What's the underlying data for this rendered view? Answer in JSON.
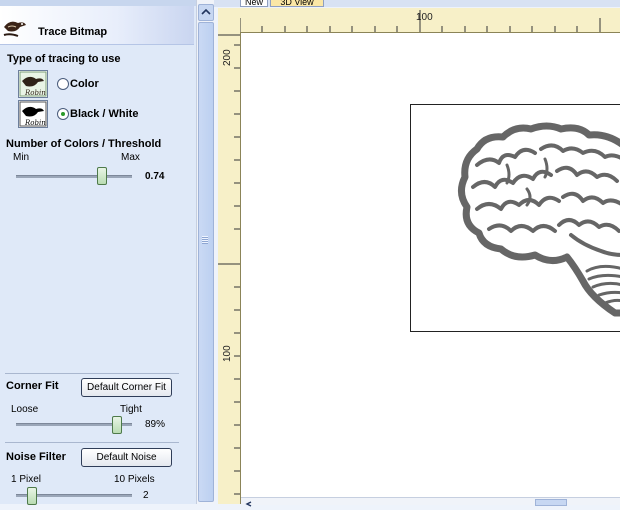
{
  "panel": {
    "title": "Trace Bitmap",
    "tracing_type": {
      "heading": "Type of tracing to use",
      "options": [
        {
          "label": "Color",
          "selected": false
        },
        {
          "label": "Black / White",
          "selected": true
        }
      ]
    },
    "threshold": {
      "heading": "Number of Colors / Threshold",
      "min_label": "Min",
      "max_label": "Max",
      "value_text": "0.74",
      "value": 0.74
    },
    "corner_fit": {
      "heading": "Corner Fit",
      "button_label": "Default Corner Fit",
      "min_label": "Loose",
      "max_label": "Tight",
      "value_text": "89%",
      "value": 0.89
    },
    "noise_filter": {
      "heading": "Noise Filter",
      "button_label": "Default Noise",
      "min_label": "1 Pixel",
      "max_label": "10 Pixels",
      "value_text": "2",
      "value": 2
    }
  },
  "tabs": [
    {
      "label": "New"
    },
    {
      "label": "3D View"
    }
  ],
  "rulers": {
    "top_labels": [
      "100"
    ],
    "left_labels": [
      "200",
      "100"
    ]
  },
  "icons": {
    "panel_icon": "trace-bitmap-icon",
    "thumbnail": "bird-thumbnail-icon"
  },
  "colors": {
    "panel_bg": "#dfe9f8",
    "ruler_bg": "#f7f0c8",
    "radio_selected": "#2a9a2a"
  }
}
